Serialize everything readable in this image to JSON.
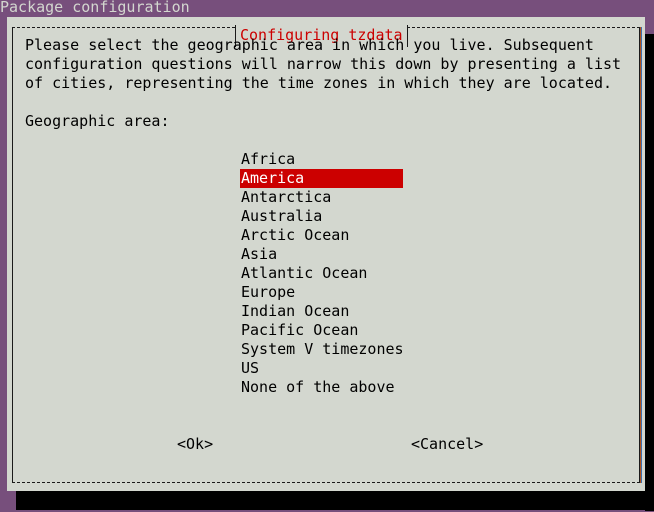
{
  "backtitle": "Package configuration",
  "dialog": {
    "title": "Configuring tzdata",
    "description_lines": [
      "Please select the geographic area in which you live. Subsequent",
      "configuration questions will narrow this down by presenting a list",
      "of cities, representing the time zones in which they are located."
    ],
    "prompt": "Geographic area:",
    "options": [
      "Africa",
      "America",
      "Antarctica",
      "Australia",
      "Arctic Ocean",
      "Asia",
      "Atlantic Ocean",
      "Europe",
      "Indian Ocean",
      "Pacific Ocean",
      "System V timezones",
      "US",
      "None of the above"
    ],
    "selected_index": 1,
    "selected_option": "America",
    "ok_label": "<Ok>",
    "cancel_label": "<Cancel>"
  },
  "colors": {
    "background": "#774f7c",
    "dialog": "#d3d7cf",
    "title": "#cc0000",
    "selection": "#cc0000",
    "selection_text": "#ffffff"
  }
}
